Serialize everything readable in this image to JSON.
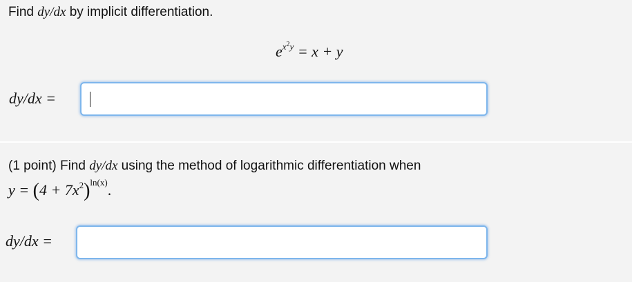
{
  "problem1": {
    "prompt_prefix": "Find",
    "prompt_math": "dy/dx",
    "prompt_suffix": "by implicit differentiation.",
    "equation": {
      "base": "e",
      "exponent_x": "x",
      "exponent_power": "2",
      "exponent_y": "y",
      "rhs": "= x + y"
    },
    "answer_label": "dy/dx =",
    "answer_value": ""
  },
  "problem2": {
    "prompt_prefix": "(1 point) Find",
    "prompt_math": "dy/dx",
    "prompt_suffix": "using the method of logarithmic differentiation when",
    "equation": {
      "lhs": "y =",
      "open_paren": "(",
      "inner": "4 + 7x",
      "inner_power": "2",
      "close_paren": ")",
      "exponent": "ln(x)",
      "end": "."
    },
    "answer_label": "dy/dx =",
    "answer_value": ""
  },
  "colors": {
    "background": "#f3f3f3",
    "input_border": "#7eb6ec",
    "input_glow": "#68a4e8"
  }
}
